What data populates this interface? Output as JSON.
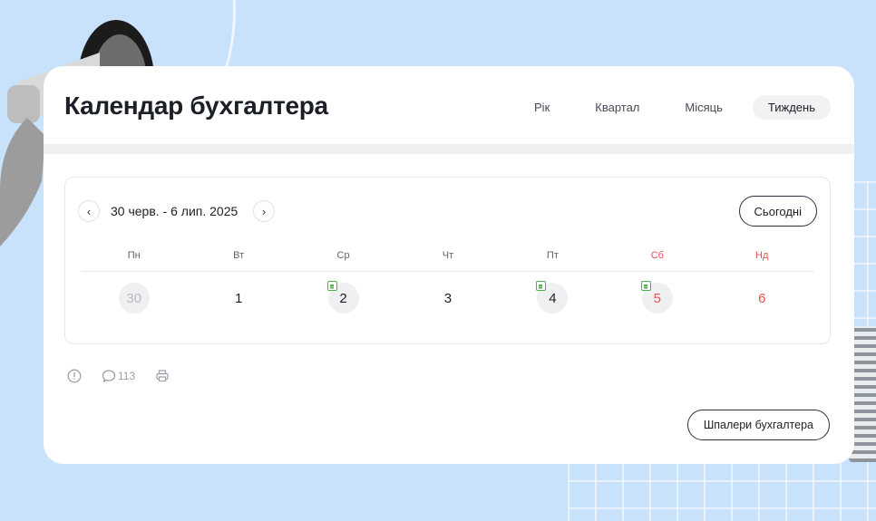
{
  "header": {
    "title": "Календар бухгалтера",
    "tabs": [
      {
        "label": "Рік",
        "active": false
      },
      {
        "label": "Квартал",
        "active": false
      },
      {
        "label": "Місяць",
        "active": false
      },
      {
        "label": "Тиждень",
        "active": true
      }
    ]
  },
  "calendar": {
    "range": "30 черв. - 6 лип. 2025",
    "prev_icon": "chevron-left-icon",
    "next_icon": "chevron-right-icon",
    "today_label": "Сьогодні",
    "weekdays": [
      "Пн",
      "Вт",
      "Ср",
      "Чт",
      "Пт",
      "Сб",
      "Нд"
    ],
    "days": [
      {
        "num": "30",
        "other_month": true,
        "event": false
      },
      {
        "num": "1",
        "other_month": false,
        "event": false
      },
      {
        "num": "2",
        "other_month": false,
        "event": true
      },
      {
        "num": "3",
        "other_month": false,
        "event": false
      },
      {
        "num": "4",
        "other_month": false,
        "event": true
      },
      {
        "num": "5",
        "other_month": false,
        "event": true
      },
      {
        "num": "6",
        "other_month": false,
        "event": false
      }
    ]
  },
  "meta": {
    "alert_icon": "alert-circle-icon",
    "comment_icon": "comment-icon",
    "comments_count": "113",
    "print_icon": "printer-icon"
  },
  "footer": {
    "wallpaper_label": "Шпалери бухгалтера"
  },
  "colors": {
    "background": "#c9e2fb",
    "weekend": "#e7534f",
    "event": "#4cb04f"
  }
}
